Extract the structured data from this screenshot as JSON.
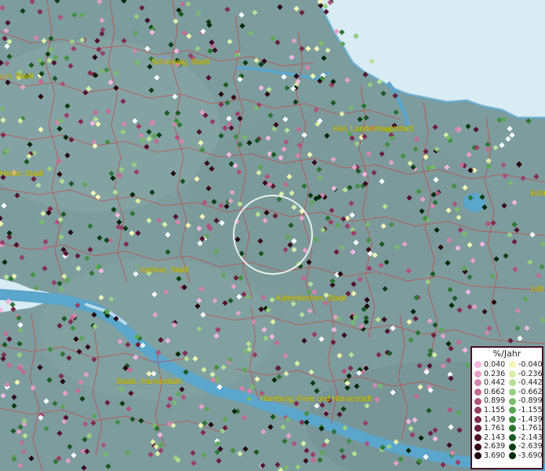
{
  "map": {
    "place_labels": [
      "um, Stadt",
      "Schleswig, Stadt",
      "Kiel, Landeshauptstadt",
      "Heide, Stadt",
      "Eutin",
      "Itzehoe, Stadt",
      "Lüb",
      "Kaltenkirchen, Stadt",
      "Stade, Hansestadt",
      "Hamburg, Freie und Hansestadt"
    ],
    "colors": {
      "land": "#7d9c9e",
      "sea": "#d9ebf3",
      "river": "#5aa6cc",
      "borders": "#d23a3a",
      "label": "#e0d000"
    }
  },
  "legend": {
    "title": "%/Jahr",
    "positive": [
      {
        "label": "0.040",
        "color": "#f5b6e0"
      },
      {
        "label": "0.236",
        "color": "#e6a0c8"
      },
      {
        "label": "0.442",
        "color": "#d685ae"
      },
      {
        "label": "0.662",
        "color": "#c46a94"
      },
      {
        "label": "0.899",
        "color": "#b0537c"
      },
      {
        "label": "1.155",
        "color": "#9a3e66"
      },
      {
        "label": "1.439",
        "color": "#842c50"
      },
      {
        "label": "1.761",
        "color": "#6c1e3e"
      },
      {
        "label": "2.143",
        "color": "#52122c"
      },
      {
        "label": "2.639",
        "color": "#3a0a1e"
      },
      {
        "label": "3.690",
        "color": "#260410"
      }
    ],
    "negative": [
      {
        "label": "-0.040",
        "color": "#f2f5b4"
      },
      {
        "label": "-0.236",
        "color": "#d8eea6"
      },
      {
        "label": "-0.442",
        "color": "#b8e094"
      },
      {
        "label": "-0.662",
        "color": "#98cf80"
      },
      {
        "label": "-0.899",
        "color": "#79bb6a"
      },
      {
        "label": "-1.155",
        "color": "#5ca655"
      },
      {
        "label": "-1.439",
        "color": "#428f42"
      },
      {
        "label": "-1.761",
        "color": "#2c7532"
      },
      {
        "label": "-2.143",
        "color": "#1a5a22"
      },
      {
        "label": "-2.639",
        "color": "#0c4014"
      },
      {
        "label": "-3.690",
        "color": "#042808"
      }
    ]
  }
}
